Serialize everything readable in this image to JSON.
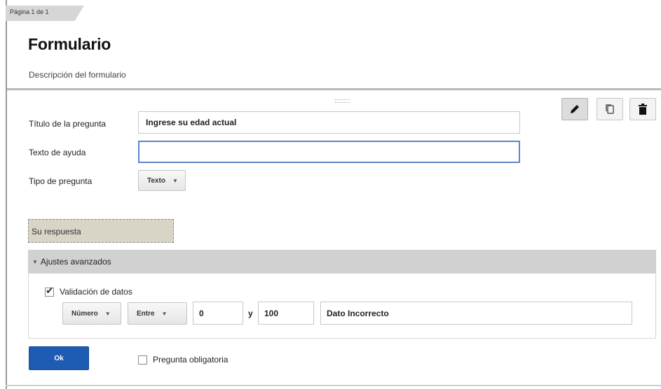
{
  "page": {
    "tab_label": "Página 1 de 1"
  },
  "form": {
    "title": "Formulario",
    "description": "Descripción del formulario"
  },
  "toolbar": {
    "edit_icon": "pencil-icon",
    "duplicate_icon": "duplicate-icon",
    "delete_icon": "trash-icon"
  },
  "question": {
    "title_label": "Título de la pregunta",
    "title_value": "Ingrese su edad actual",
    "help_label": "Texto de ayuda",
    "help_value": "",
    "type_label": "Tipo de pregunta",
    "type_value": "Texto"
  },
  "response_placeholder": "Su respuesta",
  "advanced": {
    "header": "Ajustes avanzados",
    "validation_label": "Validación de datos",
    "validation_checked": true,
    "kind_value": "Número",
    "condition_value": "Entre",
    "min_value": "0",
    "connector": "y",
    "max_value": "100",
    "error_text": "Dato Incorrecto"
  },
  "actions": {
    "ok_label": "Ok",
    "required_label": "Pregunta obligatoria",
    "required_checked": false
  },
  "colors": {
    "ok_button": "#1e5bb3",
    "focus_border": "#5b86c9",
    "response_fill": "#d8d5c6",
    "advanced_bar": "#d1d1d1"
  }
}
